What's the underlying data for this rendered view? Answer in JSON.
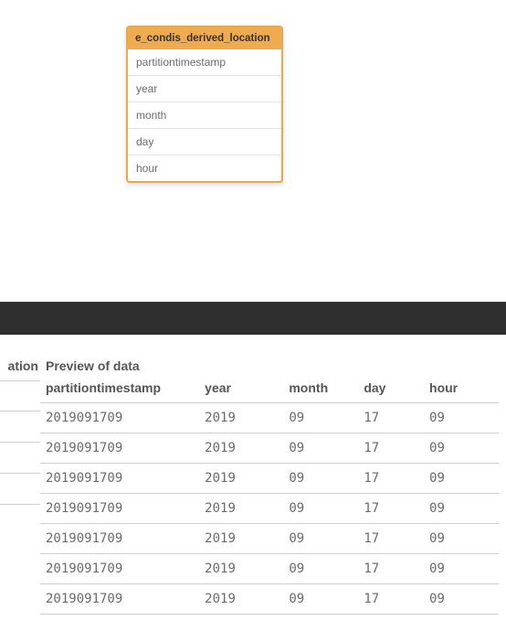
{
  "entity": {
    "title": "e_condis_derived_location",
    "fields": [
      "partitiontimestamp",
      "year",
      "month",
      "day",
      "hour"
    ]
  },
  "left_fragment": {
    "heading": "ation",
    "blank_rows": 4
  },
  "preview": {
    "title": "Preview of data",
    "columns": [
      "partitiontimestamp",
      "year",
      "month",
      "day",
      "hour"
    ],
    "rows": [
      [
        "2019091709",
        "2019",
        "09",
        "17",
        "09"
      ],
      [
        "2019091709",
        "2019",
        "09",
        "17",
        "09"
      ],
      [
        "2019091709",
        "2019",
        "09",
        "17",
        "09"
      ],
      [
        "2019091709",
        "2019",
        "09",
        "17",
        "09"
      ],
      [
        "2019091709",
        "2019",
        "09",
        "17",
        "09"
      ],
      [
        "2019091709",
        "2019",
        "09",
        "17",
        "09"
      ],
      [
        "2019091709",
        "2019",
        "09",
        "17",
        "09"
      ]
    ]
  }
}
